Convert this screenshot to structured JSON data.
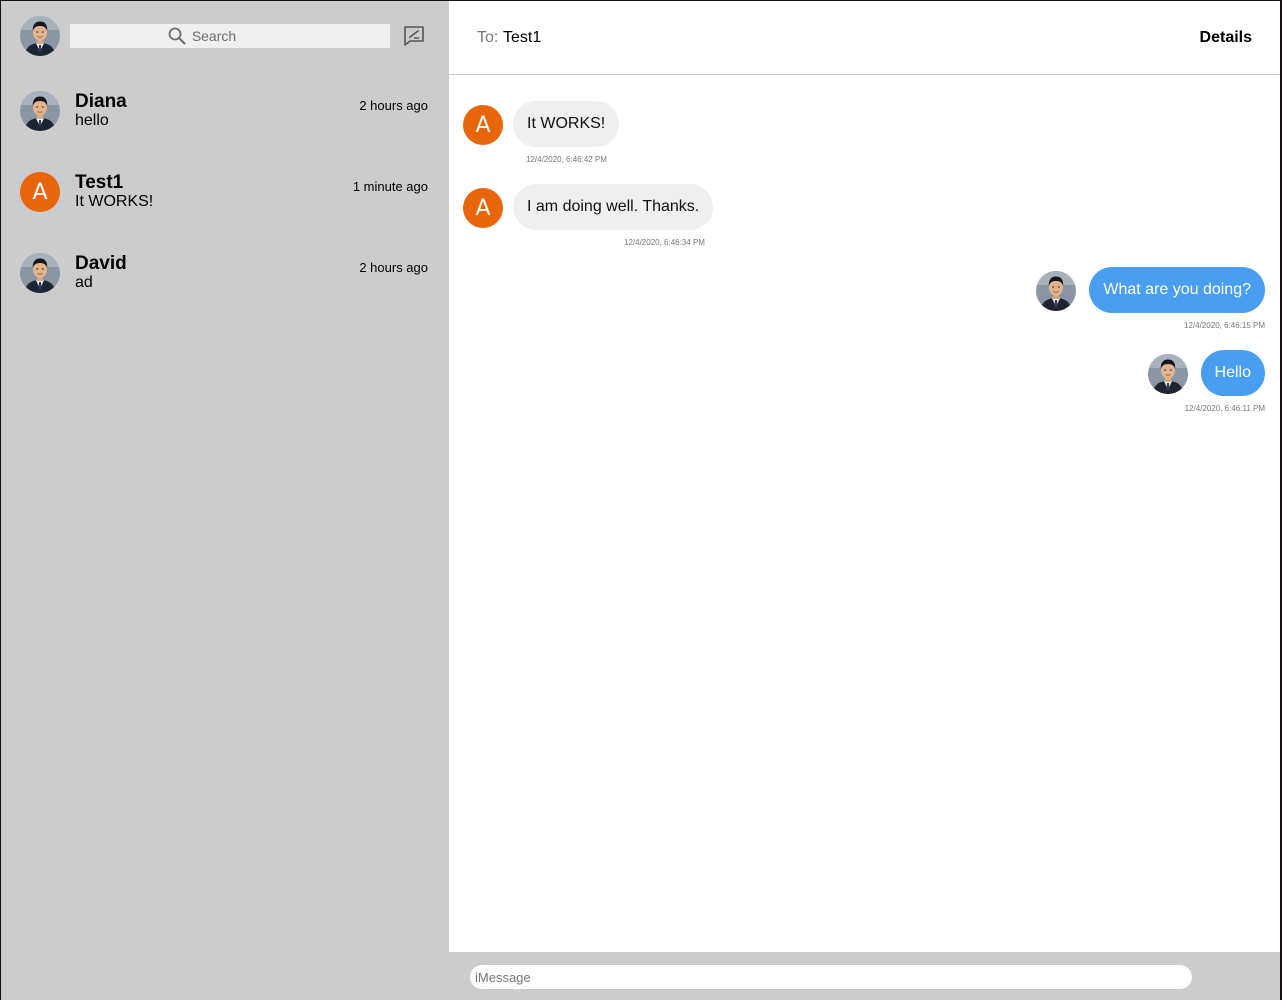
{
  "sidebar": {
    "search_placeholder": "Search",
    "conversations": [
      {
        "name": "Diana",
        "preview": "hello",
        "time": "2 hours ago",
        "avatar": "photo"
      },
      {
        "name": "Test1",
        "preview": "It WORKS!",
        "time": "1 minute ago",
        "avatar": "letter",
        "initial": "A"
      },
      {
        "name": "David",
        "preview": "ad",
        "time": "2 hours ago",
        "avatar": "photo"
      }
    ]
  },
  "header": {
    "to_label": "To:",
    "to_name": "Test1",
    "details_label": "Details"
  },
  "messages": [
    {
      "direction": "in",
      "text": "It WORKS!",
      "timestamp": "12/4/2020, 6:46:42 PM",
      "initial": "A"
    },
    {
      "direction": "in",
      "text": "I am doing well. Thanks.",
      "timestamp": "12/4/2020, 6:46:34 PM",
      "initial": "A"
    },
    {
      "direction": "out",
      "text": "What are you doing?",
      "timestamp": "12/4/2020, 6:46:15 PM"
    },
    {
      "direction": "out",
      "text": "Hello",
      "timestamp": "12/4/2020, 6:46:11 PM"
    }
  ],
  "composer": {
    "placeholder": "iMessage"
  },
  "colors": {
    "sidebar_bg": "#cccccc",
    "incoming_bubble": "#efefef",
    "outgoing_bubble": "#4a9ef2",
    "letter_avatar": "#e8650a"
  },
  "icons": {
    "search": "search-icon",
    "compose": "compose-icon"
  }
}
